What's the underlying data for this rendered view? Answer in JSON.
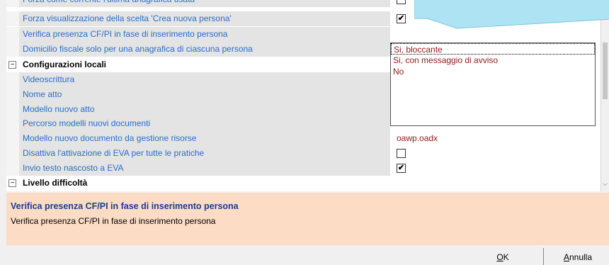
{
  "rows": [
    {
      "name": "Forza come corrente l'ultima anagrafica usata",
      "value": "",
      "type": "check-partial"
    },
    {
      "name": "Forza visualizzazione della scelta 'Crea nuova persona'",
      "value": "✔",
      "type": "check"
    },
    {
      "name": "Verifica presenza CF/PI in fase di inserimento persona",
      "value": "",
      "type": "text"
    },
    {
      "name": "Domicilio fiscale solo per una anagrafica di ciascuna persona",
      "value": "",
      "type": "dropdown"
    }
  ],
  "category_local": {
    "label": "Configurazioni locali",
    "toggle": "−"
  },
  "local_rows": [
    {
      "name": "Videoscrittura",
      "value": ""
    },
    {
      "name": "Nome atto",
      "value": ""
    },
    {
      "name": "Modello nuovo atto",
      "value": ""
    },
    {
      "name": "Percorso modelli nuovi documenti",
      "value": ""
    },
    {
      "name": "Modello nuovo documento da gestione risorse",
      "value": "oawp.oadx"
    },
    {
      "name": "Disattiva l'attivazione di EVA per tutte le pratiche",
      "value": ""
    },
    {
      "name": "Invio testo nascosto a EVA",
      "value": "✔"
    }
  ],
  "category_level": {
    "label": "Livello difficoltà",
    "toggle": "−"
  },
  "dropdown": {
    "options": [
      "Si, bloccante",
      "Si, con messaggio di avviso",
      "No"
    ],
    "selected": "Si, bloccante"
  },
  "help": {
    "title": "Verifica presenza CF/PI in fase di inserimento persona",
    "description": "Verifica presenza CF/PI in fase di inserimento persona"
  },
  "buttons": {
    "ok_prefix": "",
    "ok_mnemonic": "O",
    "ok_rest": "K",
    "cancel_mnemonic": "A",
    "cancel_rest": "nnulla"
  },
  "colors": {
    "name_text": "#2a6ec6",
    "value_text": "#8b1a1a",
    "help_bg": "#fcdcc4",
    "help_title": "#1a3c8f",
    "tooltip_fill": "#aee3f3"
  }
}
